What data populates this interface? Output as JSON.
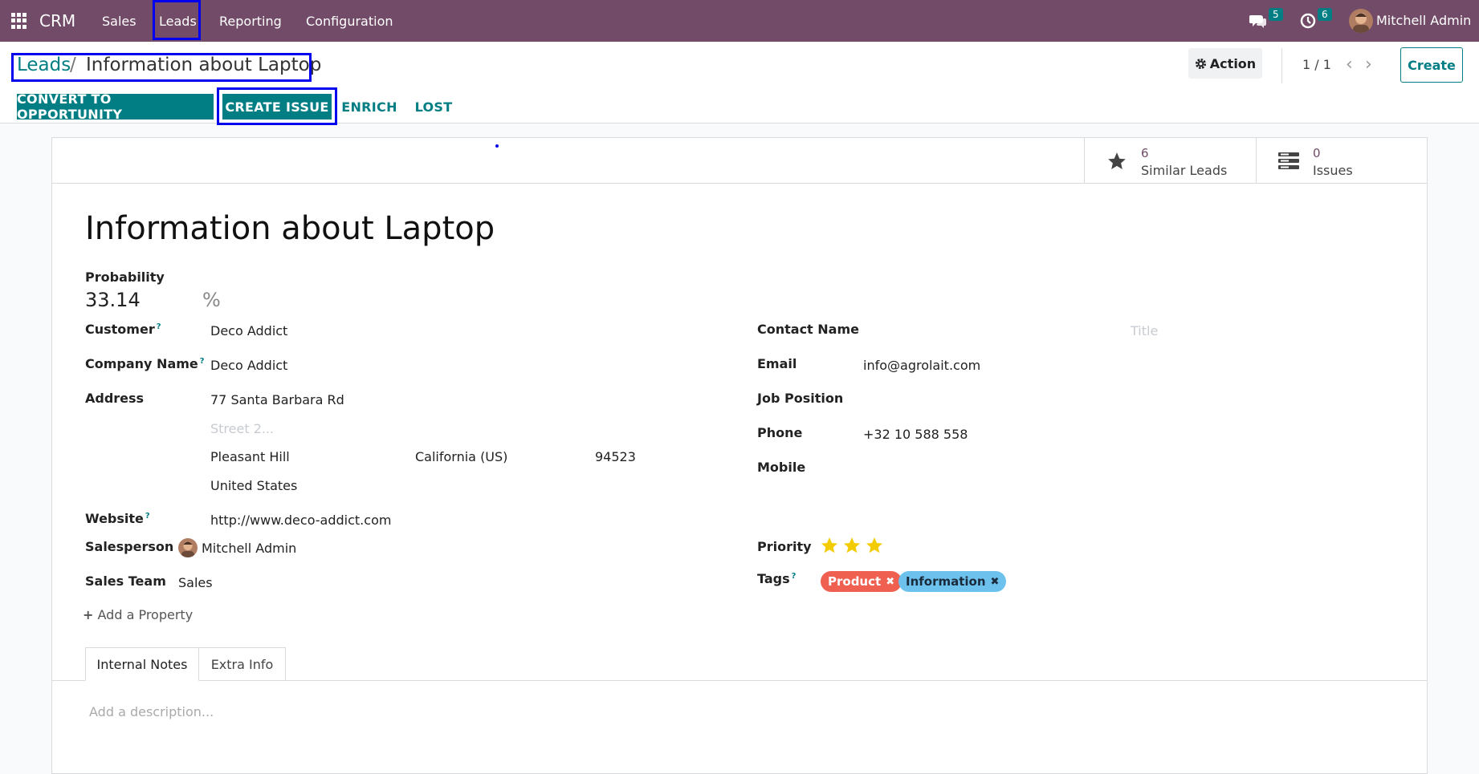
{
  "navbar": {
    "brand": "CRM",
    "menu": [
      "Sales",
      "Leads",
      "Reporting",
      "Configuration"
    ],
    "messages_count": "5",
    "activities_count": "6",
    "user_name": "Mitchell Admin"
  },
  "control": {
    "breadcrumb_parent": "Leads",
    "breadcrumb_sep": "/",
    "breadcrumb_current": "Information about Laptop",
    "action_label": "Action",
    "pager": "1 / 1",
    "create_label": "Create"
  },
  "header_buttons": {
    "convert": "CONVERT TO OPPORTUNITY",
    "create_issue": "CREATE ISSUE",
    "enrich": "ENRICH",
    "lost": "LOST"
  },
  "smart_buttons": [
    {
      "value": "6",
      "label": "Similar Leads",
      "icon": "star-icon"
    },
    {
      "value": "0",
      "label": "Issues",
      "icon": "list-icon"
    }
  ],
  "form": {
    "title": "Information about Laptop",
    "probability_label": "Probability",
    "probability_value": "33.14",
    "probability_unit": "%",
    "customer_label": "Customer",
    "customer_value": "Deco Addict",
    "company_label": "Company Name",
    "company_value": "Deco Addict",
    "address_label": "Address",
    "street": "77 Santa Barbara Rd",
    "street2_placeholder": "Street 2...",
    "city": "Pleasant Hill",
    "state": "California (US)",
    "zip": "94523",
    "country": "United States",
    "website_label": "Website",
    "website_value": "http://www.deco-addict.com",
    "salesperson_label": "Salesperson",
    "salesperson_value": "Mitchell Admin",
    "team_label": "Sales Team",
    "team_value": "Sales",
    "contact_label": "Contact Name",
    "title_placeholder": "Title",
    "email_label": "Email",
    "email_value": "info@agrolait.com",
    "job_label": "Job Position",
    "phone_label": "Phone",
    "phone_value": "+32 10 588 558",
    "mobile_label": "Mobile",
    "priority_label": "Priority",
    "priority_stars": 3,
    "tags_label": "Tags",
    "tags": [
      {
        "name": "Product",
        "color": "#f06050"
      },
      {
        "name": "Information",
        "color": "#6cc1ed"
      }
    ],
    "add_property": "Add a Property",
    "help_mark": "?"
  },
  "tabs": [
    "Internal Notes",
    "Extra Info"
  ],
  "description_placeholder": "Add a description...",
  "colors": {
    "brand": "#714b67",
    "accent": "#017e84",
    "star": "#f3cc00"
  }
}
